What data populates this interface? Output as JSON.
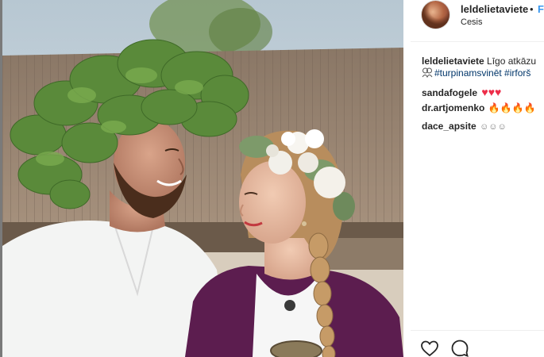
{
  "post": {
    "author": "leldelietaviete",
    "separator": "•",
    "follow_label": "Follow",
    "location": "Cesis"
  },
  "caption": {
    "username": "leldelietaviete",
    "text": " Līgo atkāzu",
    "hashtags": "#turpinamsvinēt #irforš"
  },
  "comments": [
    {
      "username": "sandafogele",
      "emoji": "♥♥♥"
    },
    {
      "username": "dr.artjomenko",
      "emoji": "🔥🔥🔥🔥"
    },
    {
      "username": "dace_apsite",
      "emoji": "☺☺☺"
    }
  ],
  "icons": {
    "like": "heart-outline-icon",
    "comment": "speech-bubble-icon"
  },
  "colors": {
    "link": "#3897f0",
    "hashtag": "#003569",
    "heart": "#ed2d49",
    "flame": "#ff7a14"
  }
}
